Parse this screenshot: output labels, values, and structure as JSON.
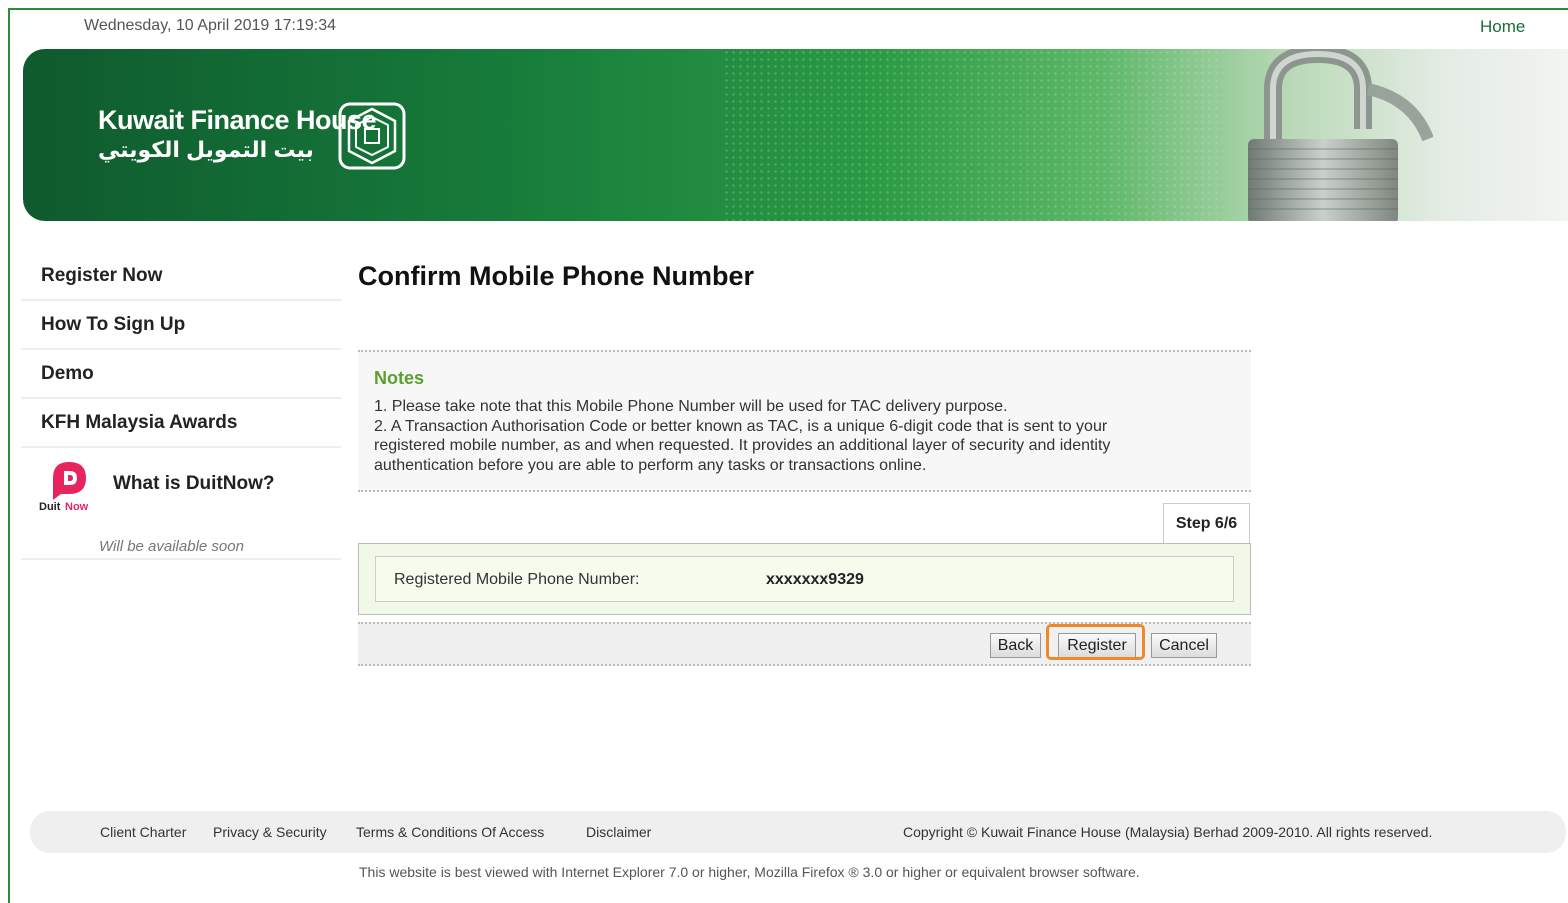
{
  "header": {
    "datetime": "Wednesday, 10 April 2019 17:19:34",
    "home_link": "Home"
  },
  "banner": {
    "brand_en": "Kuwait Finance House",
    "brand_ar": "بيت التمويل الكويتي"
  },
  "sidebar": {
    "items": [
      {
        "label": "Register Now"
      },
      {
        "label": "How To Sign Up"
      },
      {
        "label": "Demo"
      },
      {
        "label": "KFH Malaysia Awards"
      }
    ],
    "duitnow": {
      "title": "What is DuitNow?",
      "logo_text_1": "Duit",
      "logo_text_2": "Now",
      "subtitle": "Will be available soon"
    }
  },
  "main": {
    "title": "Confirm Mobile Phone Number",
    "notes": {
      "heading": "Notes",
      "lines": [
        "1. Please take note that this Mobile Phone Number will be used for TAC delivery purpose.",
        "2. A Transaction Authorisation Code or better known as TAC, is a unique 6-digit code that is sent to your",
        "registered mobile number, as and when requested. It provides an additional layer of security and identity",
        "authentication before you are able to perform any tasks or transactions online."
      ]
    },
    "step": "Step 6/6",
    "registered_label": "Registered Mobile Phone Number:",
    "registered_value": "xxxxxxx9329",
    "buttons": {
      "back": "Back",
      "register": "Register",
      "cancel": "Cancel"
    }
  },
  "footer": {
    "links": [
      "Client Charter",
      "Privacy & Security",
      "Terms & Conditions Of Access",
      "Disclaimer"
    ],
    "copyright": "Copyright © Kuwait Finance House (Malaysia) Berhad 2009-2010. All rights reserved.",
    "browser_note": "This website is best viewed with Internet Explorer 7.0 or higher, Mozilla Firefox ® 3.0 or higher or equivalent browser software."
  },
  "colors": {
    "brand_green": "#167a3a",
    "notes_heading": "#5aa02c",
    "highlight": "#ef8a2a",
    "duitnow_pink": "#e8245f"
  }
}
